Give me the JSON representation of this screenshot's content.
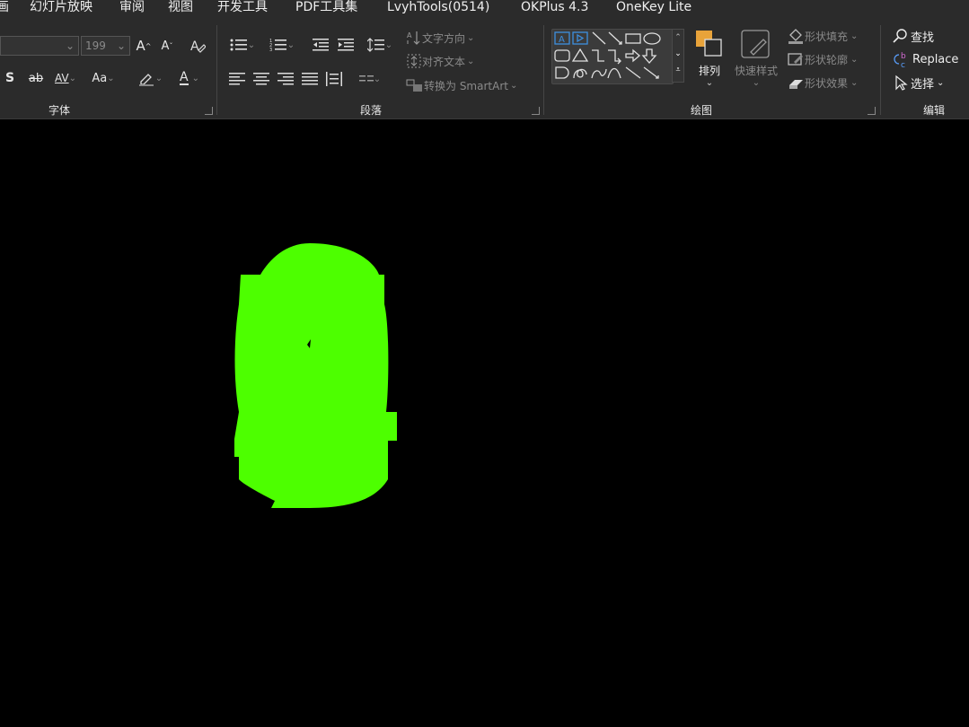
{
  "menu": {
    "items": [
      {
        "label": "画"
      },
      {
        "label": "幻灯片放映"
      },
      {
        "label": "审阅"
      },
      {
        "label": "视图"
      },
      {
        "label": "开发工具"
      },
      {
        "label": "PDF工具集"
      },
      {
        "label": "LvyhTools(0514)"
      },
      {
        "label": "OKPlus 4.3"
      },
      {
        "label": "OneKey Lite"
      }
    ]
  },
  "font_group": {
    "label": "字体",
    "font_size": "199",
    "grow": "A",
    "shrink": "A",
    "shadow": "S",
    "strike": "ab",
    "spacing": "AV",
    "case": "Aa",
    "font_color": "A"
  },
  "paragraph_group": {
    "label": "段落",
    "text_direction": "文字方向",
    "align_text": "对齐文本",
    "convert_smartart": "转换为 SmartArt"
  },
  "drawing_group": {
    "label": "绘图",
    "arrange": "排列",
    "quick_styles": "快速样式",
    "shape_fill": "形状填充",
    "shape_outline": "形状轮廓",
    "shape_effects": "形状效果"
  },
  "editing_group": {
    "label": "编辑",
    "find": "查找",
    "replace": "Replace",
    "select": "选择"
  },
  "colors": {
    "shape_fill": "#4dff00",
    "ribbon_bg": "#2b2b2b",
    "canvas_bg": "#000000",
    "accent_orange": "#e8a33a",
    "accent_blue": "#3c8fe0"
  }
}
